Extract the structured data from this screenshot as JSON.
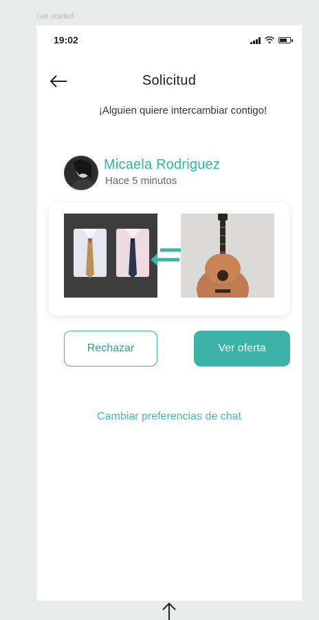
{
  "frame": {
    "label": "Get started"
  },
  "status_bar": {
    "time": "19:02",
    "battery_level": 0.8
  },
  "header": {
    "title": "Solicitud",
    "back_icon": "arrow-left-icon"
  },
  "message": {
    "text": "¡Alguien quiere intercambiar contigo!"
  },
  "user": {
    "name": "Micaela Rodriguez",
    "time_ago": "Hace 5 minutos"
  },
  "trade": {
    "offered_item": "shirts-and-ties",
    "requested_item": "ukulele",
    "swap_icon": "swap-arrows-icon"
  },
  "actions": {
    "reject_label": "Rechazar",
    "view_offer_label": "Ver oferta"
  },
  "chat_link": {
    "label": "Cambiar preferencias de chat"
  },
  "colors": {
    "accent": "#3bb3a6",
    "accent_text": "#2fb5a6",
    "background": "#e9ebea"
  }
}
